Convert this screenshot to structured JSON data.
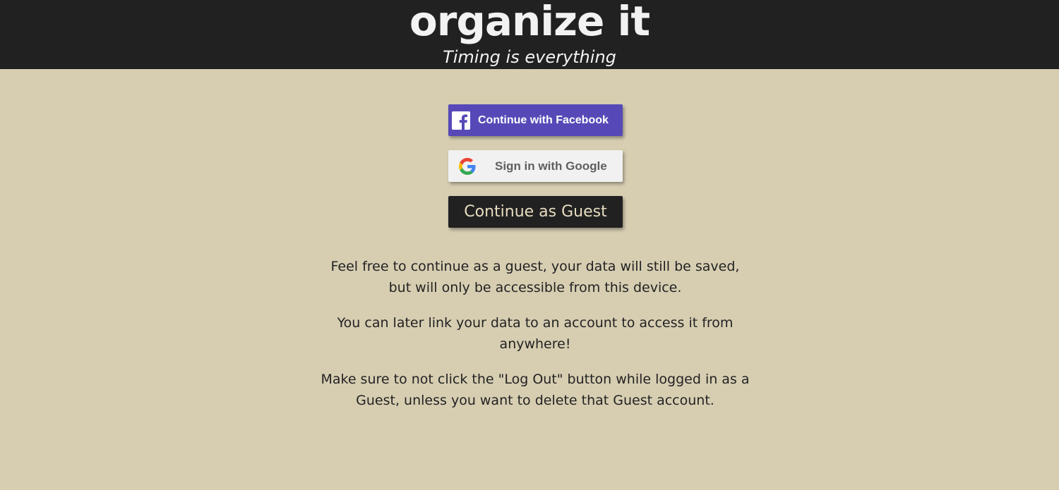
{
  "header": {
    "title": "organize it",
    "tagline": "Timing is everything"
  },
  "auth": {
    "facebook_label": "Continue with Facebook",
    "google_label": "Sign in with Google",
    "guest_label": "Continue as Guest"
  },
  "info": {
    "paragraphs": [
      "Feel free to continue as a guest, your data will still be saved, but will only be accessible from this device.",
      "You can later link your data to an account to access it from anywhere!",
      "Make sure to not click the \"Log Out\" button while logged in as a Guest, unless you want to delete that Guest account."
    ]
  },
  "icons": {
    "facebook": "facebook-icon",
    "google": "google-icon"
  },
  "colors": {
    "background": "#d7ceb2",
    "header": "#212121",
    "facebook": "#5649b7",
    "google_button": "#f1f1f1",
    "guest_button": "#212121",
    "guest_text": "#e6dcc0"
  }
}
